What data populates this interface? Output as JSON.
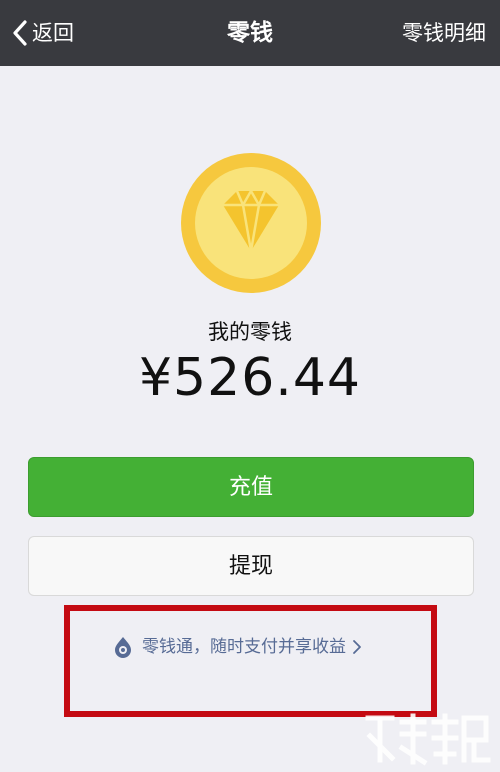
{
  "navbar": {
    "back_label": "返回",
    "title": "零钱",
    "right_label": "零钱明细",
    "background": "#393a3f"
  },
  "icons": {
    "back": "chevron-left-icon",
    "coin": "diamond-coin-icon",
    "lqt": "lingqiantong-drop-icon",
    "link_arrow": "chevron-right-icon"
  },
  "balance": {
    "label": "我的零钱",
    "amount": "¥526.44"
  },
  "buttons": {
    "recharge_label": "充值",
    "withdraw_label": "提现",
    "recharge_color": "#44b035"
  },
  "lqt_link": {
    "text": "零钱通，随时支付并享收益",
    "color": "#576b95"
  },
  "highlight_color": "#c40a12"
}
